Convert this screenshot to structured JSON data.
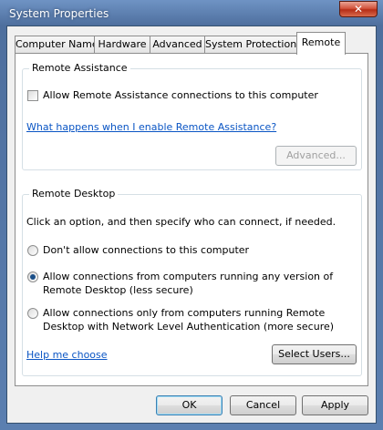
{
  "window": {
    "title": "System Properties"
  },
  "tabs": [
    "Computer Name",
    "Hardware",
    "Advanced",
    "System Protection",
    "Remote"
  ],
  "remote_assistance": {
    "group_label": "Remote Assistance",
    "allow_checkbox_label": "Allow Remote Assistance connections to this computer",
    "allow_checked": false,
    "help_link": "What happens when I enable Remote Assistance?",
    "advanced_button": "Advanced..."
  },
  "remote_desktop": {
    "group_label": "Remote Desktop",
    "instruction": "Click an option, and then specify who can connect, if needed.",
    "options": [
      {
        "line1": "Don't allow connections to this computer",
        "line2": "",
        "selected": false
      },
      {
        "line1": "Allow connections from computers running any version of",
        "line2": "Remote Desktop (less secure)",
        "selected": true
      },
      {
        "line1": "Allow connections only from computers running Remote",
        "line2": "Desktop with Network Level Authentication (more secure)",
        "selected": false
      }
    ],
    "help_link": "Help me choose",
    "select_users_button": "Select Users..."
  },
  "footer": {
    "ok": "OK",
    "cancel": "Cancel",
    "apply": "Apply"
  }
}
